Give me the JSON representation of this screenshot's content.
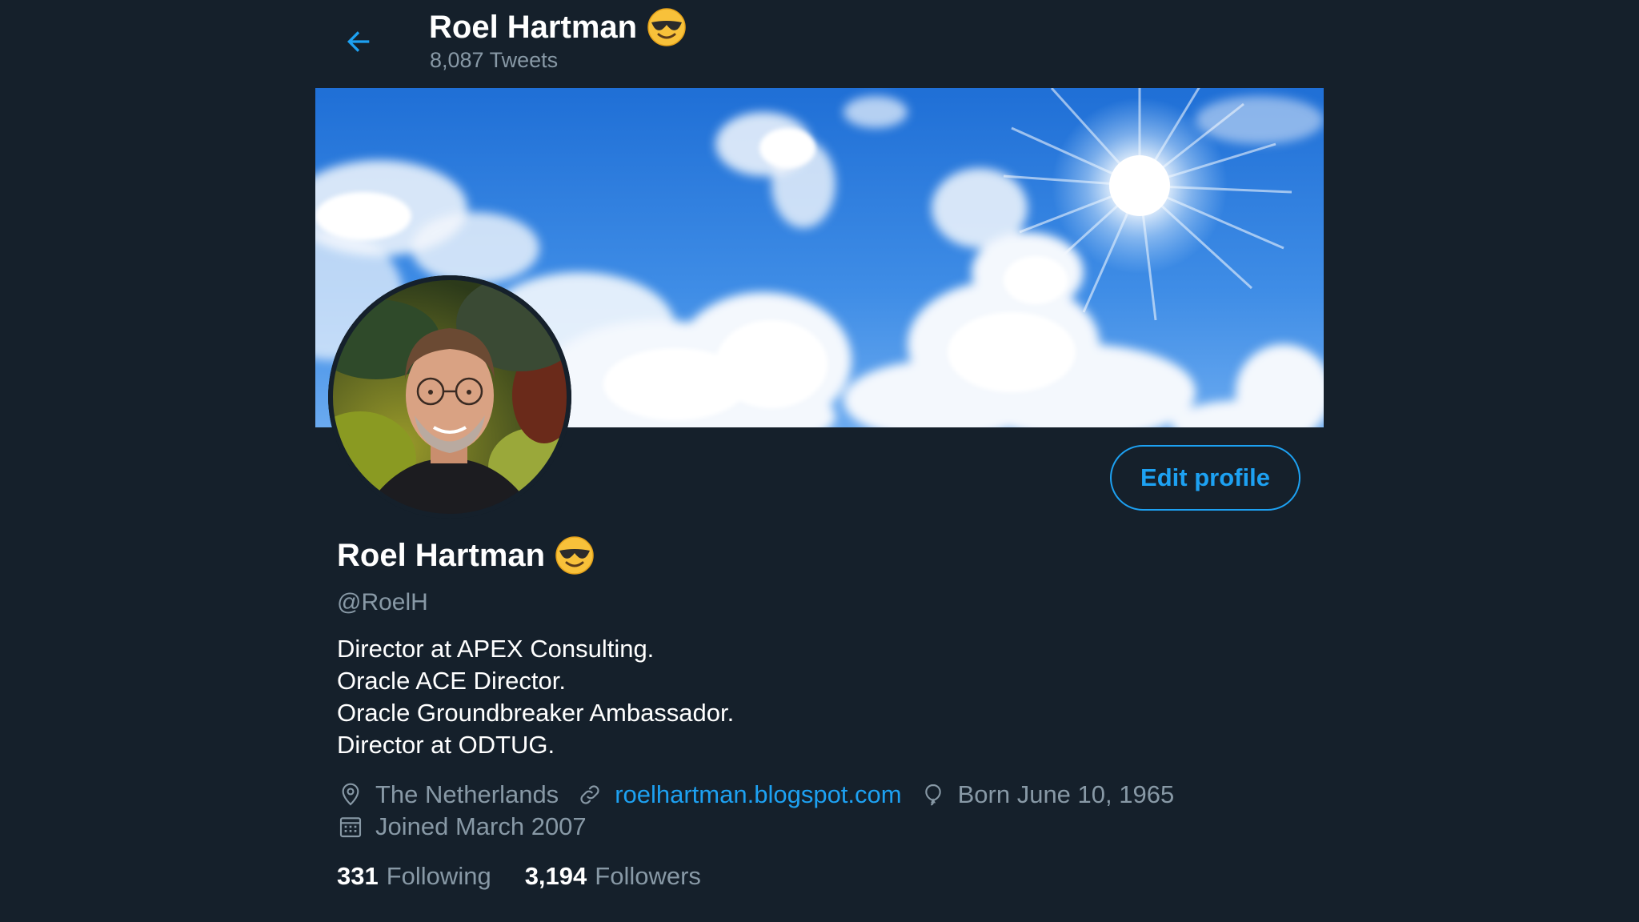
{
  "header": {
    "title": "Roel Hartman",
    "tweet_count": "8,087 Tweets",
    "title_emoji": "smiling-face-with-sunglasses-emoji"
  },
  "banner": {
    "description": "sky-with-sun-and-clouds"
  },
  "profile": {
    "display_name": "Roel Hartman",
    "handle": "@RoelH",
    "bio": [
      "Director at APEX Consulting.",
      "Oracle ACE Director.",
      "Oracle Groundbreaker Ambassador.",
      "Director at ODTUG."
    ],
    "location": "The Netherlands",
    "website": "roelhartman.blogspot.com",
    "birthday": "Born June 10, 1965",
    "joined": "Joined March 2007",
    "following_count": "331",
    "following_label": "Following",
    "followers_count": "3,194",
    "followers_label": "Followers"
  },
  "actions": {
    "edit_profile_label": "Edit profile"
  },
  "colors": {
    "background": "#15202b",
    "accent": "#1da1f2",
    "secondary_text": "#8899a6",
    "primary_text": "#ffffff"
  },
  "icons": {
    "back": "arrow-left-icon",
    "location": "location-pin-icon",
    "website": "link-icon",
    "birthday": "balloon-icon",
    "joined": "calendar-icon"
  }
}
